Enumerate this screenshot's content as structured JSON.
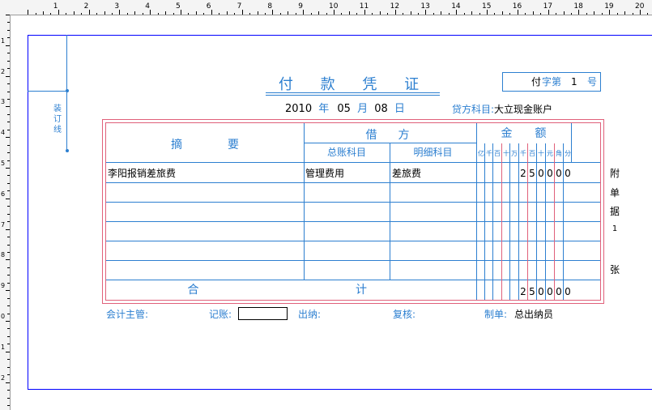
{
  "ruler": {
    "numbers": [
      "1",
      "2",
      "3",
      "4",
      "5",
      "6",
      "7",
      "8",
      "9",
      "10",
      "11",
      "12",
      "13",
      "14",
      "15",
      "16",
      "17",
      "18",
      "19",
      "20"
    ],
    "left_numbers": [
      "1",
      "2",
      "3",
      "4",
      "5",
      "6",
      "7",
      "8",
      "9",
      "0",
      "1",
      "2"
    ]
  },
  "binding": {
    "label": "装订线"
  },
  "voucher": {
    "title": "付 款 凭 证",
    "type_char": "付",
    "type_word": "字第",
    "number": "1",
    "number_suffix": "号",
    "year": "2010",
    "year_label": "年",
    "month": "05",
    "month_label": "月",
    "day": "08",
    "day_label": "日",
    "credit_label": "贷方科目:",
    "credit_account": "大立现金账户"
  },
  "table": {
    "summary_header": "摘　　　　要",
    "debit_header": "借　方",
    "general_account_header": "总账科目",
    "detail_account_header": "明细科目",
    "amount_header": "金　　额",
    "units": [
      "亿",
      "千",
      "百",
      "十",
      "万",
      "千",
      "百",
      "十",
      "元",
      "角",
      "分"
    ],
    "rows": [
      {
        "summary": "李阳报销差旅费",
        "general": "管理费用",
        "detail": "差旅费",
        "digits": [
          "",
          "",
          "",
          "",
          "",
          "2",
          "5",
          "0",
          "0",
          "0",
          "0"
        ]
      },
      {
        "summary": "",
        "general": "",
        "detail": "",
        "digits": [
          "",
          "",
          "",
          "",
          "",
          "",
          "",
          "",
          "",
          "",
          ""
        ]
      },
      {
        "summary": "",
        "general": "",
        "detail": "",
        "digits": [
          "",
          "",
          "",
          "",
          "",
          "",
          "",
          "",
          "",
          "",
          ""
        ]
      },
      {
        "summary": "",
        "general": "",
        "detail": "",
        "digits": [
          "",
          "",
          "",
          "",
          "",
          "",
          "",
          "",
          "",
          "",
          ""
        ]
      },
      {
        "summary": "",
        "general": "",
        "detail": "",
        "digits": [
          "",
          "",
          "",
          "",
          "",
          "",
          "",
          "",
          "",
          "",
          ""
        ]
      },
      {
        "summary": "",
        "general": "",
        "detail": "",
        "digits": [
          "",
          "",
          "",
          "",
          "",
          "",
          "",
          "",
          "",
          "",
          ""
        ]
      }
    ],
    "total_label_1": "合",
    "total_label_2": "计",
    "total_digits": [
      "",
      "",
      "",
      "",
      "",
      "2",
      "5",
      "0",
      "0",
      "0",
      "0"
    ]
  },
  "attachments": {
    "char1": "附",
    "char2": "单",
    "char3": "据",
    "count": "1",
    "char4": "张"
  },
  "signatures": {
    "supervisor_label": "会计主管:",
    "bookkeeper_label": "记账:",
    "bookkeeper_value": "",
    "cashier_label": "出纳:",
    "reviewer_label": "复核:",
    "maker_label": "制单:",
    "maker_value": "总出纳员"
  }
}
